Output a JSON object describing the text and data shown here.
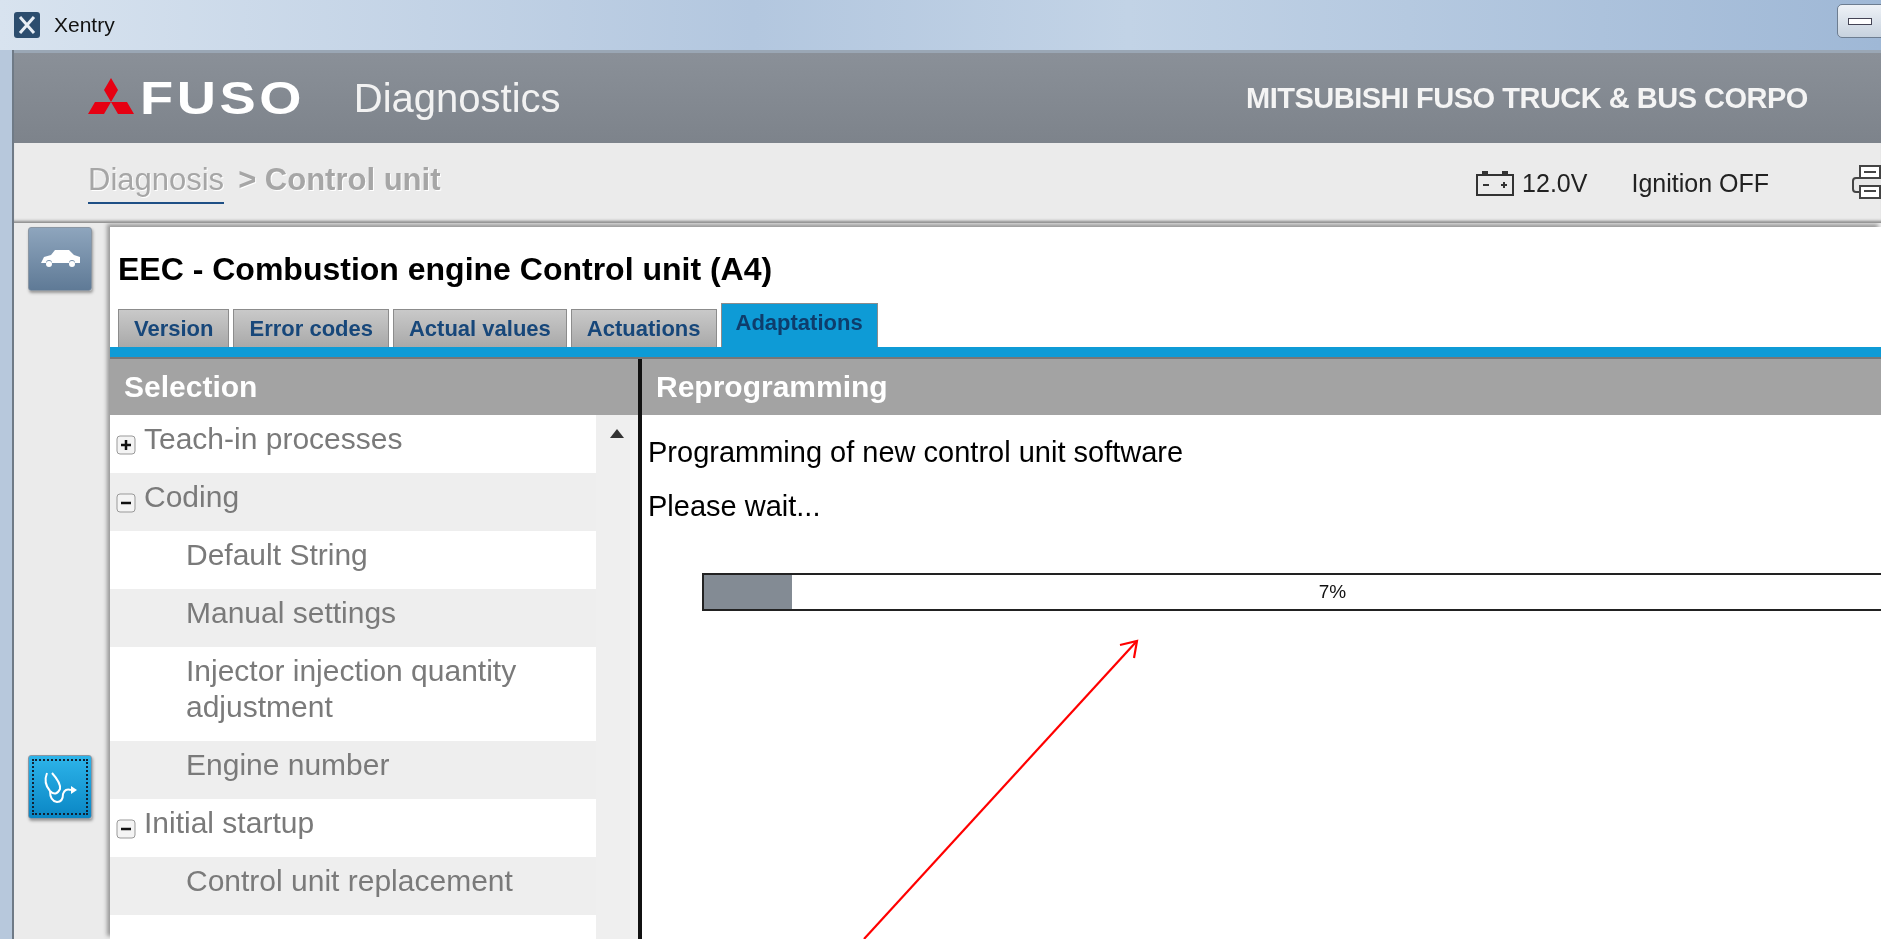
{
  "window": {
    "title": "Xentry"
  },
  "header": {
    "brand": "FUSO",
    "app_name": "Diagnostics",
    "company": "MITSUBISHI FUSO TRUCK & BUS CORPO"
  },
  "breadcrumb": [
    {
      "label": "Diagnosis",
      "kind": "link"
    },
    {
      "label": "> Control unit",
      "kind": "current"
    }
  ],
  "status": {
    "voltage": "12.0V",
    "ignition": "Ignition OFF"
  },
  "side_buttons": [
    {
      "kind": "vehicle",
      "selected": false
    },
    {
      "kind": "diagnosis",
      "selected": true
    }
  ],
  "unit_title": "EEC - Combustion engine Control unit (A4)",
  "tabs": [
    {
      "label": "Version",
      "selected": false
    },
    {
      "label": "Error codes",
      "selected": false
    },
    {
      "label": "Actual values",
      "selected": false
    },
    {
      "label": "Actuations",
      "selected": false
    },
    {
      "label": "Adaptations",
      "selected": true
    }
  ],
  "selection": {
    "title": "Selection",
    "items": [
      {
        "label": "Teach-in processes",
        "expanded": false
      },
      {
        "label": "Coding",
        "expanded": true,
        "children": [
          {
            "label": "Default String"
          },
          {
            "label": "Manual settings"
          },
          {
            "label": "Injector injection quantity adjustment"
          },
          {
            "label": "Engine number"
          }
        ]
      },
      {
        "label": "Initial startup",
        "expanded": true,
        "children": [
          {
            "label": "Control unit replacement"
          }
        ]
      }
    ]
  },
  "content": {
    "title": "Reprogramming",
    "lines": [
      "Programming of new control unit software",
      "Please wait..."
    ],
    "progress": {
      "level": 0.07,
      "label": "7%"
    }
  }
}
